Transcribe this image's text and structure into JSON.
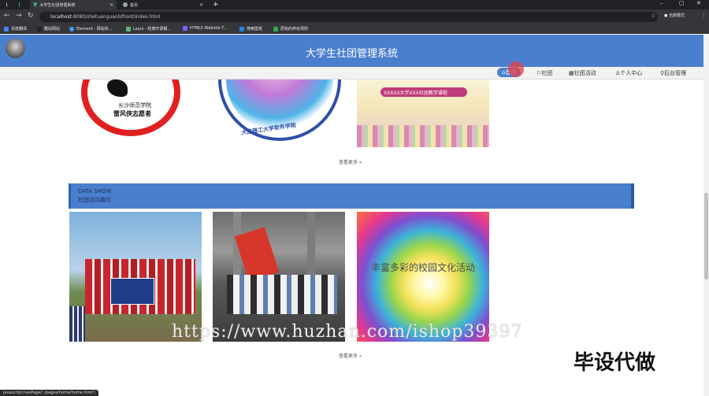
{
  "browser": {
    "tabs": [
      {
        "label": "大学生社团管理系统",
        "active": true
      },
      {
        "label": "首页",
        "active": false
      }
    ],
    "url_host": "localhost",
    "url_rest": ":8080/shetuanguanli/front/index.html",
    "incognito_label": "无痕模式",
    "bookmarks": [
      "百度翻译",
      "酷站网站",
      "Element - 网站快...",
      "Layui - 经典开源模...",
      "HTML5 Website T...",
      "搜索壁纸",
      "原始的命名规则"
    ]
  },
  "site": {
    "title": "大学生社团管理系统",
    "nav": [
      "首页",
      "社团",
      "社团活动",
      "个人中心",
      "后台管理"
    ],
    "nav_active": "首页"
  },
  "section1": {
    "more_label": "查看更多 »",
    "images": [
      {
        "caption_top": "长沙师范学院",
        "caption_bottom": "雷风侠志愿者"
      },
      {
        "caption": "大连理工大学软件学院"
      },
      {
        "caption": "XXXXX大学XXX社团教学课程"
      }
    ]
  },
  "section2": {
    "title_en": "DATA SHOW",
    "title_cn": "社团活动展示",
    "more_label": "查看更多 »",
    "images": [
      {
        "caption": ""
      },
      {
        "caption": ""
      },
      {
        "caption": "丰富多彩的校园文化活动"
      }
    ]
  },
  "overlay": {
    "watermark": "https://www.huzhan.com/ishop39397",
    "stamp": "毕设代做",
    "status_url": "javascript:navPage('./pages/home/home.html')"
  },
  "colors": {
    "primary": "#4a7fce"
  }
}
